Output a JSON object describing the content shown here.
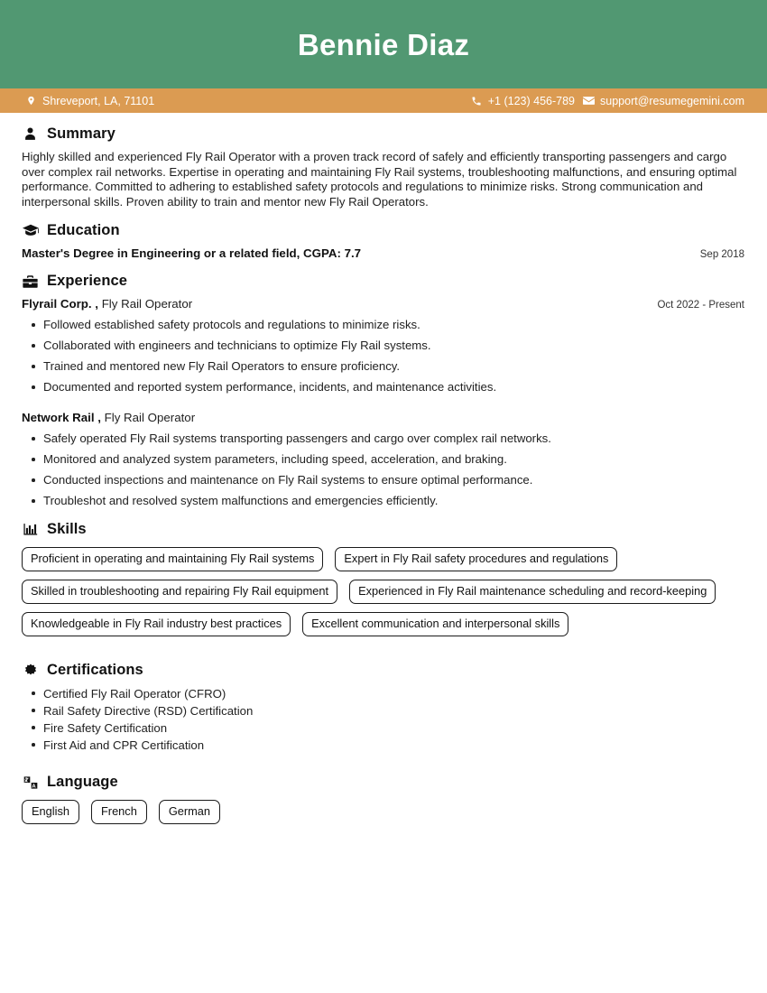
{
  "header": {
    "full_name": "Bennie Diaz",
    "band_color": "#519872",
    "contact_bar_color": "#db9b52",
    "location": "Shreveport, LA, 71101",
    "phone": "+1 (123) 456-789",
    "email": "support@resumegemini.com",
    "location_icon": "map-pin-icon",
    "phone_icon": "phone-icon",
    "email_icon": "envelope-icon"
  },
  "sections": {
    "summary": {
      "title": "Summary",
      "icon": "user-icon",
      "text": "Highly skilled and experienced Fly Rail Operator with a proven track record of safely and efficiently transporting passengers and cargo over complex rail networks. Expertise in operating and maintaining Fly Rail systems, troubleshooting malfunctions, and ensuring optimal performance. Committed to adhering to established safety protocols and regulations to minimize risks. Strong communication and interpersonal skills. Proven ability to train and mentor new Fly Rail Operators."
    },
    "education": {
      "title": "Education",
      "icon": "graduation-cap-icon",
      "entries": [
        {
          "degree": "Master's Degree in Engineering or a related field, CGPA: 7.7",
          "date": "Sep 2018"
        }
      ]
    },
    "experience": {
      "title": "Experience",
      "icon": "briefcase-icon",
      "jobs": [
        {
          "company": "Flyrail Corp. ,",
          "role": "Fly Rail Operator",
          "date": "Oct 2022 - Present",
          "bullets": [
            "Followed established safety protocols and regulations to minimize risks.",
            "Collaborated with engineers and technicians to optimize Fly Rail systems.",
            "Trained and mentored new Fly Rail Operators to ensure proficiency.",
            "Documented and reported system performance, incidents, and maintenance activities."
          ]
        },
        {
          "company": "Network Rail ,",
          "role": "Fly Rail Operator",
          "date": "",
          "bullets": [
            "Safely operated Fly Rail systems transporting passengers and cargo over complex rail networks.",
            "Monitored and analyzed system parameters, including speed, acceleration, and braking.",
            "Conducted inspections and maintenance on Fly Rail systems to ensure optimal performance.",
            "Troubleshot and resolved system malfunctions and emergencies efficiently."
          ]
        }
      ]
    },
    "skills": {
      "title": "Skills",
      "icon": "bar-chart-icon",
      "items": [
        "Proficient in operating and maintaining Fly Rail systems",
        "Expert in Fly Rail safety procedures and regulations",
        "Skilled in troubleshooting and repairing Fly Rail equipment",
        "Experienced in Fly Rail maintenance scheduling and record-keeping",
        "Knowledgeable in Fly Rail industry best practices",
        "Excellent communication and interpersonal skills"
      ]
    },
    "certifications": {
      "title": "Certifications",
      "icon": "award-badge-icon",
      "items": [
        "Certified Fly Rail Operator (CFRO)",
        "Rail Safety Directive (RSD) Certification",
        "Fire Safety Certification",
        "First Aid and CPR Certification"
      ]
    },
    "language": {
      "title": "Language",
      "icon": "translate-icon",
      "items": [
        "English",
        "French",
        "German"
      ]
    }
  }
}
